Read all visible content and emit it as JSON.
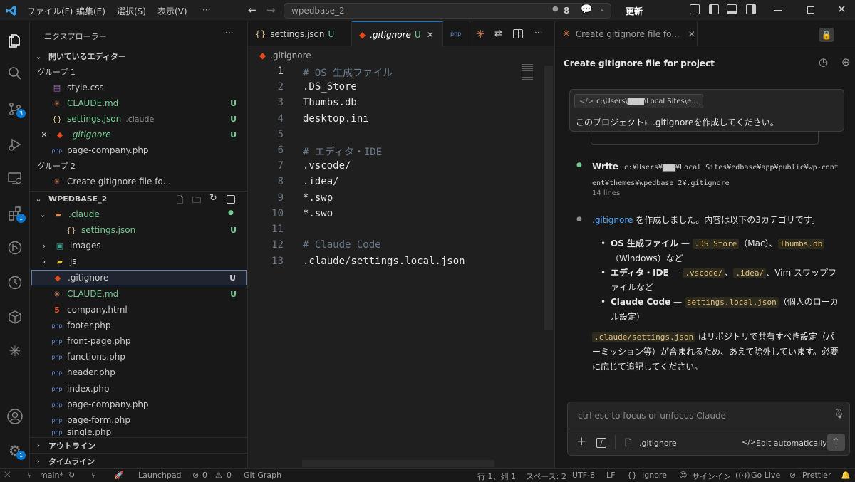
{
  "titlebar": {
    "menus": [
      "ファイル(F)",
      "編集(E)",
      "選択(S)",
      "表示(V)",
      "···"
    ],
    "search_text": "wpedbase_2",
    "count": "8",
    "update_label": "更新"
  },
  "activity": {
    "source_control_badge": "3",
    "extensions_badge": "1",
    "settings_badge": "1"
  },
  "sidebar": {
    "title": "エクスプローラー",
    "open_editors_label": "開いているエディター",
    "group1_label": "グループ 1",
    "group2_label": "グループ 2",
    "open_editors": [
      {
        "name": "style.css",
        "note": "",
        "status": ""
      },
      {
        "name": "CLAUDE.md",
        "note": "",
        "status": "U"
      },
      {
        "name": "settings.json",
        "note": ".claude",
        "status": "U"
      },
      {
        "name": ".gitignore",
        "note": "",
        "status": "U"
      },
      {
        "name": "page-company.php",
        "note": "",
        "status": ""
      }
    ],
    "group2_item": "Create gitignore file fo...",
    "project_label": "WPEDBASE_2",
    "tree": [
      {
        "name": ".claude",
        "status": ""
      },
      {
        "name": "settings.json",
        "status": "U"
      },
      {
        "name": "images",
        "status": ""
      },
      {
        "name": "js",
        "status": ""
      },
      {
        "name": ".gitignore",
        "status": "U"
      },
      {
        "name": "CLAUDE.md",
        "status": "U"
      },
      {
        "name": "company.html",
        "status": ""
      },
      {
        "name": "footer.php",
        "status": ""
      },
      {
        "name": "front-page.php",
        "status": ""
      },
      {
        "name": "functions.php",
        "status": ""
      },
      {
        "name": "header.php",
        "status": ""
      },
      {
        "name": "index.php",
        "status": ""
      },
      {
        "name": "page-company.php",
        "status": ""
      },
      {
        "name": "page-form.php",
        "status": ""
      },
      {
        "name": "single.php",
        "status": ""
      }
    ],
    "outline_label": "アウトライン",
    "timeline_label": "タイムライン"
  },
  "editor": {
    "tabs": [
      {
        "name": "settings.json",
        "status": "U"
      },
      {
        "name": ".gitignore",
        "status": "U"
      }
    ],
    "breadcrumb": ".gitignore",
    "line_numbers": [
      "1",
      "2",
      "3",
      "4",
      "5",
      "6",
      "7",
      "8",
      "9",
      "10",
      "11",
      "12",
      "13"
    ],
    "lines": [
      "# OS 生成ファイル",
      ".DS_Store",
      "Thumbs.db",
      "desktop.ini",
      "",
      "# エディタ・IDE",
      ".vscode/",
      ".idea/",
      "*.swp",
      "*.swo",
      "",
      "# Claude Code",
      ".claude/settings.local.json"
    ]
  },
  "chat": {
    "tab_title": "Create gitignore file fo...",
    "header_title": "Create gitignore file for project",
    "context_chip": "c:\\Users\\▇▇▇\\Local Sites\\e...",
    "user_message": "このプロジェクトに.gitignoreを作成してください。",
    "write_label": "Write",
    "write_path": "c:¥Users¥▇▇▇¥Local Sites¥edbase¥app¥public¥wp-content¥themes¥wpedbase_2¥.gitignore",
    "write_lines": "14 lines",
    "response_link": ".gitignore",
    "response_intro": " を作成しました。内容は以下の3カテゴリです。",
    "bullets": [
      {
        "bold": "OS 生成ファイル",
        "sep": " — ",
        "code1": ".DS_Store",
        "mid": "（Mac）、",
        "code2": "Thumbs.db",
        "tail": "（Windows）など"
      },
      {
        "bold": "エディタ・IDE",
        "sep": " — ",
        "code1": ".vscode/",
        "mid": "、",
        "code2": ".idea/",
        "tail": "、Vim スワップファイルなど"
      },
      {
        "bold": "Claude Code",
        "sep": " — ",
        "code1": "settings.local.json",
        "mid": "",
        "code2": "",
        "tail": "（個人のローカル設定）"
      }
    ],
    "outro_code": ".claude/settings.json",
    "outro_text": " はリポジトリで共有すべき設定（パーミッション等）が含まれるため、あえて除外しています。必要に応じて追記してください。",
    "input_placeholder": "ctrl esc to focus or unfocus Claude",
    "attachment": ".gitignore",
    "edit_mode": "Edit automatically"
  },
  "statusbar": {
    "branch": "main*",
    "launchpad": "Launchpad",
    "errors": "0",
    "warnings": "0",
    "git_graph": "Git Graph",
    "position": "行 1、列 1",
    "spaces": "スペース: 2",
    "encoding": "UTF-8",
    "eol": "LF",
    "language": "Ignore",
    "signin": "サインイン",
    "golive": "Go Live",
    "prettier": "Prettier"
  },
  "colors": {
    "accent": "#0078d4",
    "untracked": "#73c991",
    "arrow": "#e01010",
    "comment": "#6a7a8a"
  }
}
